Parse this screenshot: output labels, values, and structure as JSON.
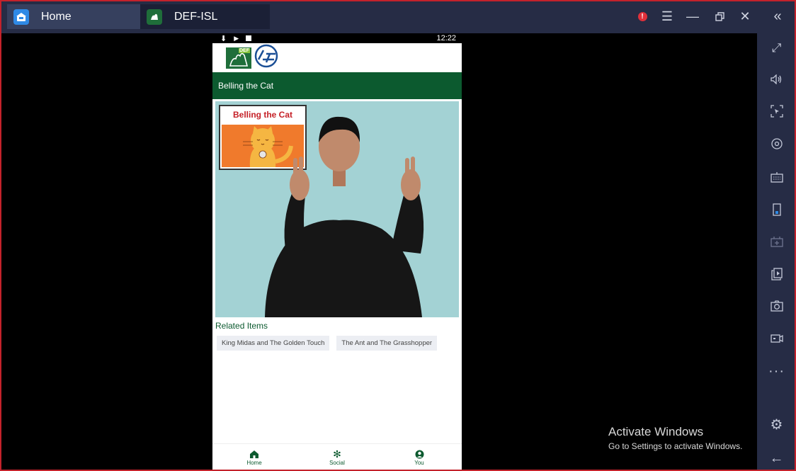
{
  "window": {
    "tabs": [
      {
        "label": "Home",
        "icon": "home-icon",
        "active": false
      },
      {
        "label": "DEF-ISL",
        "icon": "def-isl-app-icon",
        "active": true
      }
    ],
    "controls": [
      "alert-icon",
      "menu-icon",
      "minimize-icon",
      "restore-icon",
      "close-icon",
      "collapse-sidebar-icon"
    ],
    "frame_color": "#c4222b"
  },
  "sidebar": {
    "items": [
      "fullscreen-icon",
      "volume-icon",
      "cursor-lock-icon",
      "eye-icon",
      "keyboard-icon",
      "phone-icon",
      "apk-install-icon",
      "copy-files-icon",
      "screenshot-icon",
      "screen-record-icon",
      "more-icon",
      "settings-icon",
      "back-arrow-icon"
    ]
  },
  "status_bar": {
    "time": "12:22"
  },
  "app": {
    "title": "Belling the Cat",
    "brand_color": "#0c5a2f",
    "logo_text": "DEF",
    "video": {
      "thumbnail_title": "Belling the Cat"
    },
    "related": {
      "heading": "Related Items",
      "items": [
        "King Midas and The Golden Touch",
        "The Ant and The Grasshopper"
      ]
    },
    "bottom_nav": [
      {
        "label": "Home",
        "icon": "home-icon"
      },
      {
        "label": "Social",
        "icon": "social-icon"
      },
      {
        "label": "You",
        "icon": "user-icon"
      }
    ]
  },
  "watermark": {
    "line1": "Activate Windows",
    "line2": "Go to Settings to activate Windows."
  }
}
